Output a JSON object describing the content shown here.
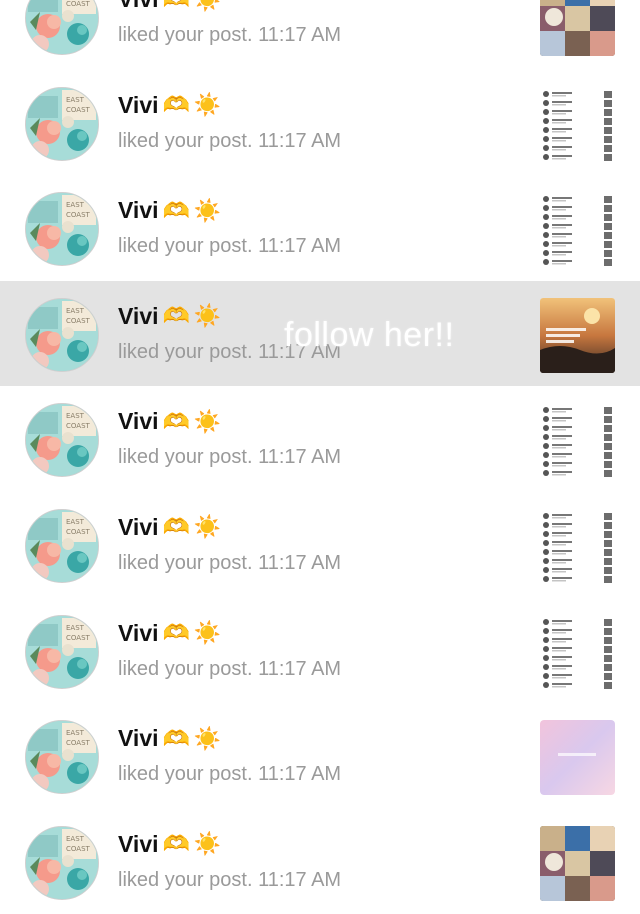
{
  "notifications": [
    {
      "name": "Vivi",
      "action": "liked your post.",
      "time": "11:17 AM",
      "thumb": "photo-collage"
    },
    {
      "name": "Vivi",
      "action": "liked your post.",
      "time": "11:17 AM",
      "thumb": "screenshot-list"
    },
    {
      "name": "Vivi",
      "action": "liked your post.",
      "time": "11:17 AM",
      "thumb": "screenshot-list"
    },
    {
      "name": "Vivi",
      "action": "liked your post.",
      "time": "11:17 AM",
      "thumb": "sunset-photo"
    },
    {
      "name": "Vivi",
      "action": "liked your post.",
      "time": "11:17 AM",
      "thumb": "screenshot-list"
    },
    {
      "name": "Vivi",
      "action": "liked your post.",
      "time": "11:17 AM",
      "thumb": "screenshot-list"
    },
    {
      "name": "Vivi",
      "action": "liked your post.",
      "time": "11:17 AM",
      "thumb": "screenshot-list"
    },
    {
      "name": "Vivi",
      "action": "liked your post.",
      "time": "11:17 AM",
      "thumb": "pastel-gradient"
    },
    {
      "name": "Vivi",
      "action": "liked your post.",
      "time": "11:17 AM",
      "thumb": "photo-collage"
    }
  ],
  "emojis": {
    "heart_hands": "🫶",
    "sun": "☀️"
  },
  "overlay_text": "follow her!!",
  "highlighted_index": 3,
  "colors": {
    "highlight_bg": "#e3e3e3",
    "subtext": "#9a9a9a",
    "name": "#111111"
  }
}
